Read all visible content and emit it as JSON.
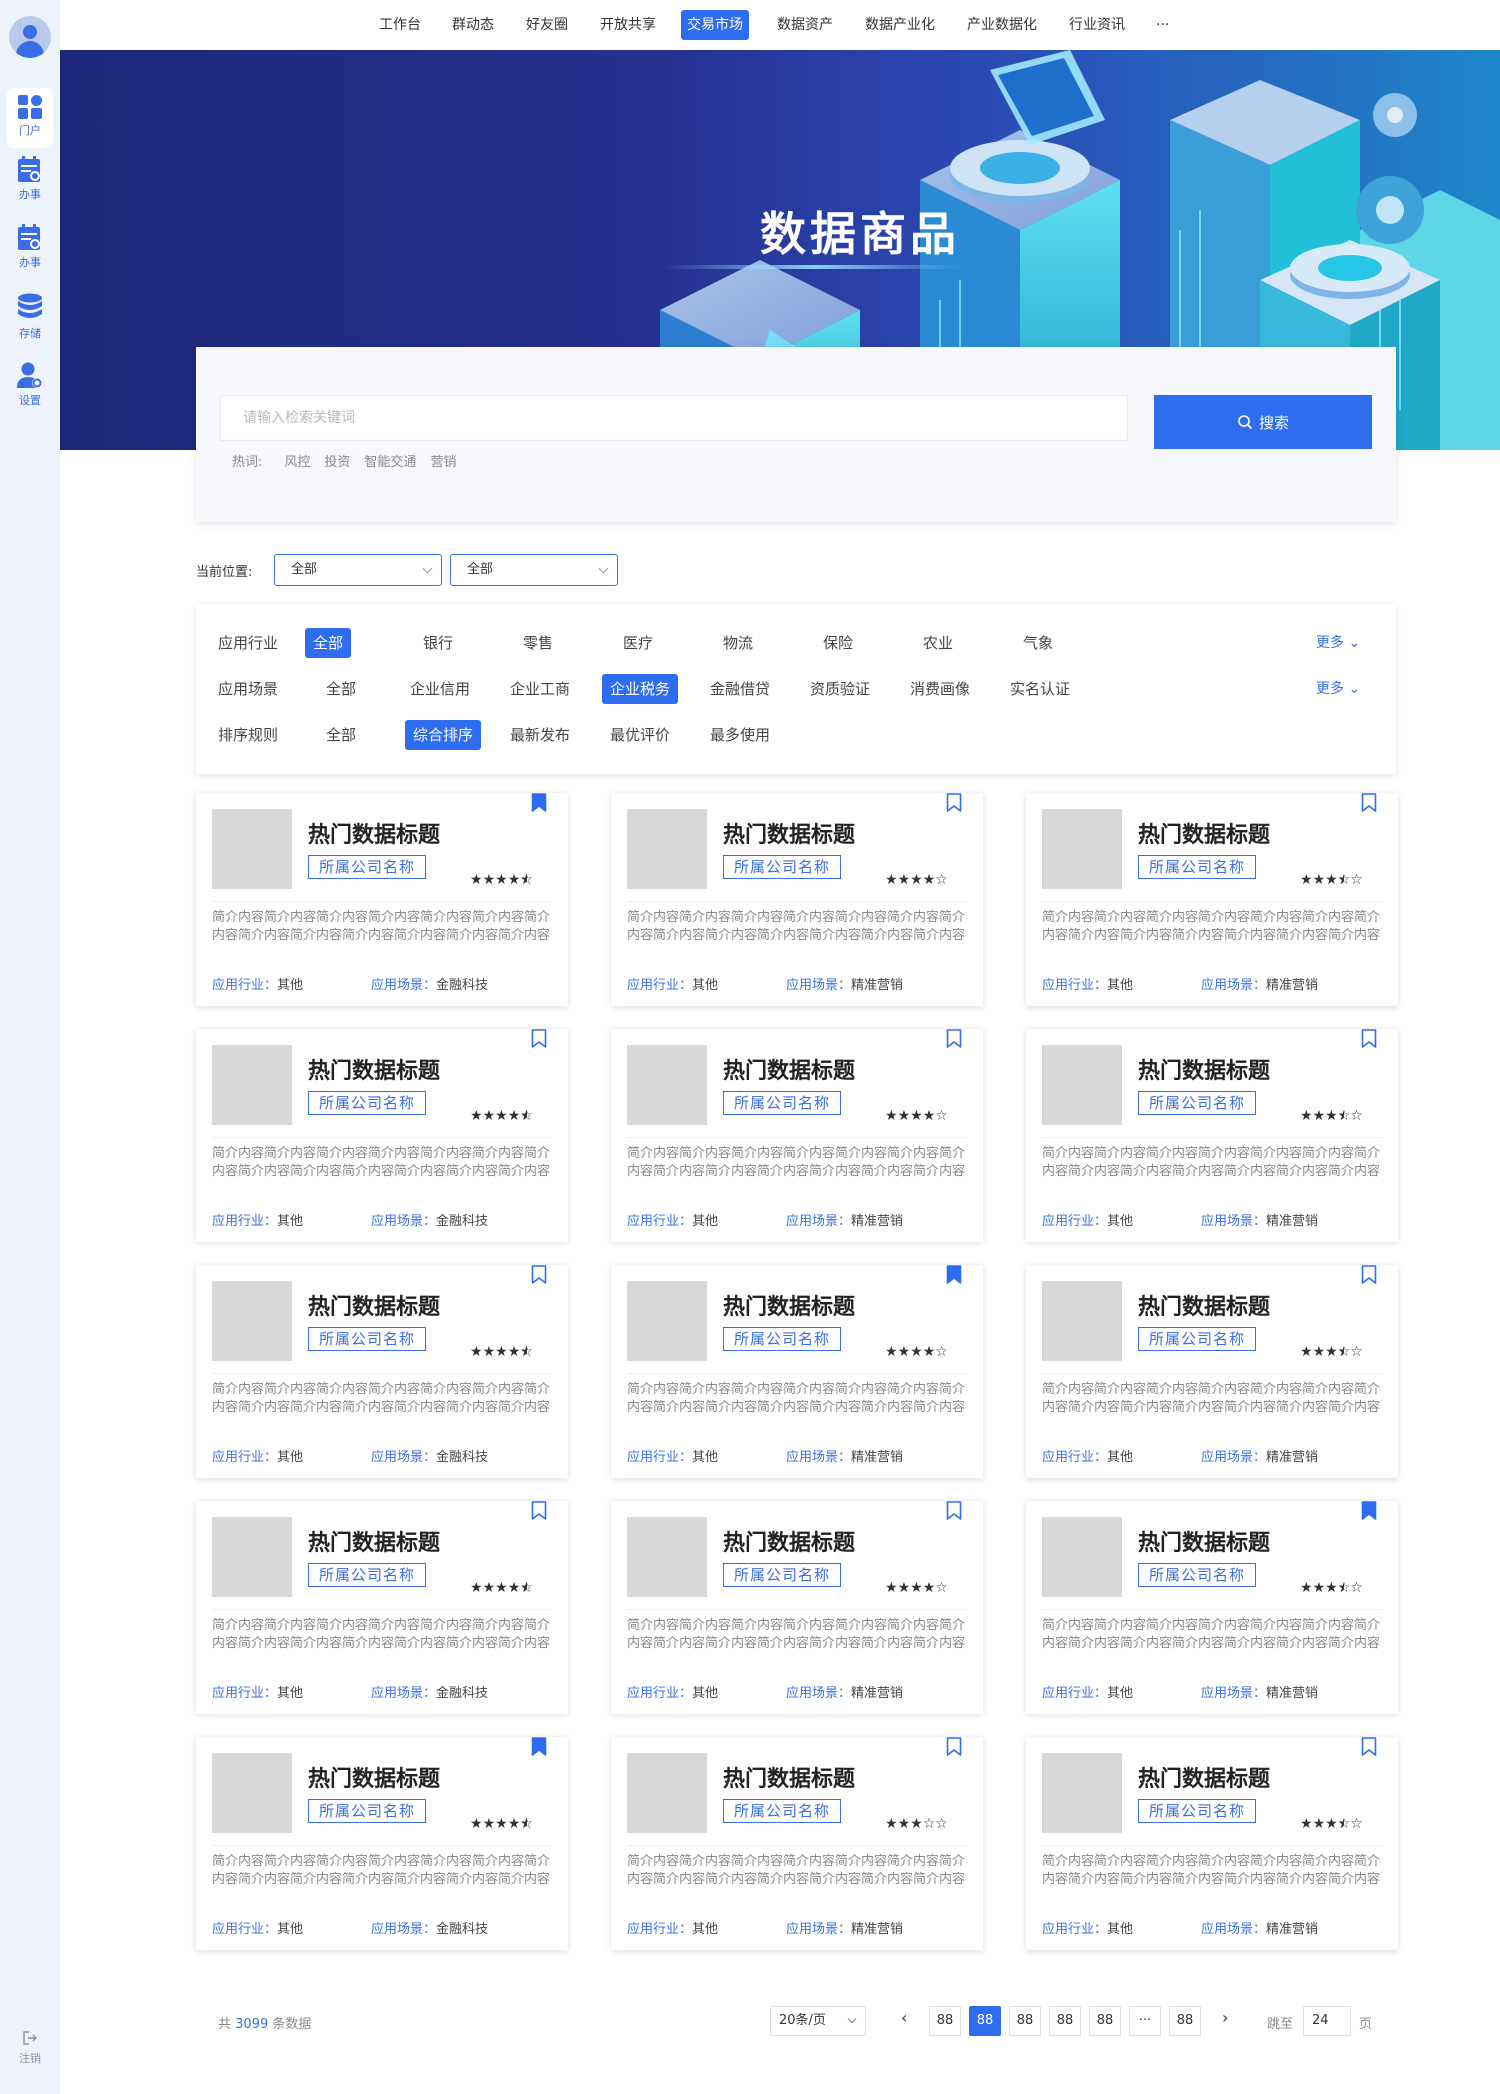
{
  "nav": {
    "items": [
      "工作台",
      "群动态",
      "好友圈",
      "开放共享",
      "交易市场",
      "数据资产",
      "数据产业化",
      "产业数据化",
      "行业资讯",
      "···"
    ],
    "active_index": 4
  },
  "sidebar": {
    "items": [
      {
        "label": "门户",
        "icon": "grid-icon"
      },
      {
        "label": "办事",
        "icon": "task-icon"
      },
      {
        "label": "办事",
        "icon": "task-icon"
      },
      {
        "label": "存储",
        "icon": "database-icon"
      },
      {
        "label": "设置",
        "icon": "user-settings-icon"
      }
    ],
    "logout": "注销"
  },
  "banner": {
    "title": "数据商品"
  },
  "search": {
    "placeholder": "请输入检索关键词",
    "button": "搜索",
    "hot_label": "热词:",
    "hot_words": [
      "风控",
      "投资",
      "智能交通",
      "营销"
    ]
  },
  "location": {
    "label": "当前位置:",
    "select1": "全部",
    "select2": "全部"
  },
  "filters": {
    "rows": [
      {
        "label": "应用行业",
        "options": [
          "全部",
          "银行",
          "零售",
          "医疗",
          "物流",
          "保险",
          "农业",
          "气象"
        ],
        "active": 0,
        "more": "更多"
      },
      {
        "label": "应用场景",
        "options": [
          "全部",
          "企业信用",
          "企业工商",
          "企业税务",
          "金融借贷",
          "资质验证",
          "消费画像",
          "实名认证"
        ],
        "active": 3,
        "more": "更多"
      },
      {
        "label": "排序规则",
        "options": [
          "全部",
          "综合排序",
          "最新发布",
          "最优评价",
          "最多使用"
        ],
        "active": 1
      }
    ]
  },
  "cards": [
    {
      "title": "热门数据标题",
      "company": "所属公司名称",
      "rating": 4.5,
      "bookmarked": true,
      "desc": "简介内容简介内容简介内容简介内容简介内容简介内容简介内容简介内容简介内容简介内容简介内容简介内容简介内容",
      "industry_label": "应用行业",
      "industry": "其他",
      "scene_label": "应用场景",
      "scene": "金融科技"
    },
    {
      "title": "热门数据标题",
      "company": "所属公司名称",
      "rating": 4,
      "bookmarked": false,
      "desc": "简介内容简介内容简介内容简介内容简介内容简介内容简介内容简介内容简介内容简介内容简介内容简介内容简介内容",
      "industry_label": "应用行业",
      "industry": "其他",
      "scene_label": "应用场景",
      "scene": "精准营销"
    },
    {
      "title": "热门数据标题",
      "company": "所属公司名称",
      "rating": 3.5,
      "bookmarked": false,
      "desc": "简介内容简介内容简介内容简介内容简介内容简介内容简介内容简介内容简介内容简介内容简介内容简介内容简介内容",
      "industry_label": "应用行业",
      "industry": "其他",
      "scene_label": "应用场景",
      "scene": "精准营销"
    },
    {
      "title": "热门数据标题",
      "company": "所属公司名称",
      "rating": 4.5,
      "bookmarked": false,
      "desc": "简介内容简介内容简介内容简介内容简介内容简介内容简介内容简介内容简介内容简介内容简介内容简介内容简介内容",
      "industry_label": "应用行业",
      "industry": "其他",
      "scene_label": "应用场景",
      "scene": "金融科技"
    },
    {
      "title": "热门数据标题",
      "company": "所属公司名称",
      "rating": 4,
      "bookmarked": false,
      "desc": "简介内容简介内容简介内容简介内容简介内容简介内容简介内容简介内容简介内容简介内容简介内容简介内容简介内容",
      "industry_label": "应用行业",
      "industry": "其他",
      "scene_label": "应用场景",
      "scene": "精准营销"
    },
    {
      "title": "热门数据标题",
      "company": "所属公司名称",
      "rating": 3.5,
      "bookmarked": false,
      "desc": "简介内容简介内容简介内容简介内容简介内容简介内容简介内容简介内容简介内容简介内容简介内容简介内容简介内容",
      "industry_label": "应用行业",
      "industry": "其他",
      "scene_label": "应用场景",
      "scene": "精准营销"
    },
    {
      "title": "热门数据标题",
      "company": "所属公司名称",
      "rating": 4.5,
      "bookmarked": false,
      "desc": "简介内容简介内容简介内容简介内容简介内容简介内容简介内容简介内容简介内容简介内容简介内容简介内容简介内容",
      "industry_label": "应用行业",
      "industry": "其他",
      "scene_label": "应用场景",
      "scene": "金融科技"
    },
    {
      "title": "热门数据标题",
      "company": "所属公司名称",
      "rating": 4,
      "bookmarked": true,
      "desc": "简介内容简介内容简介内容简介内容简介内容简介内容简介内容简介内容简介内容简介内容简介内容简介内容简介内容",
      "industry_label": "应用行业",
      "industry": "其他",
      "scene_label": "应用场景",
      "scene": "精准营销"
    },
    {
      "title": "热门数据标题",
      "company": "所属公司名称",
      "rating": 3.5,
      "bookmarked": false,
      "desc": "简介内容简介内容简介内容简介内容简介内容简介内容简介内容简介内容简介内容简介内容简介内容简介内容简介内容",
      "industry_label": "应用行业",
      "industry": "其他",
      "scene_label": "应用场景",
      "scene": "精准营销"
    },
    {
      "title": "热门数据标题",
      "company": "所属公司名称",
      "rating": 4.5,
      "bookmarked": false,
      "desc": "简介内容简介内容简介内容简介内容简介内容简介内容简介内容简介内容简介内容简介内容简介内容简介内容简介内容",
      "industry_label": "应用行业",
      "industry": "其他",
      "scene_label": "应用场景",
      "scene": "金融科技"
    },
    {
      "title": "热门数据标题",
      "company": "所属公司名称",
      "rating": 4,
      "bookmarked": false,
      "desc": "简介内容简介内容简介内容简介内容简介内容简介内容简介内容简介内容简介内容简介内容简介内容简介内容简介内容",
      "industry_label": "应用行业",
      "industry": "其他",
      "scene_label": "应用场景",
      "scene": "精准营销"
    },
    {
      "title": "热门数据标题",
      "company": "所属公司名称",
      "rating": 3.5,
      "bookmarked": true,
      "desc": "简介内容简介内容简介内容简介内容简介内容简介内容简介内容简介内容简介内容简介内容简介内容简介内容简介内容",
      "industry_label": "应用行业",
      "industry": "其他",
      "scene_label": "应用场景",
      "scene": "精准营销"
    },
    {
      "title": "热门数据标题",
      "company": "所属公司名称",
      "rating": 4.5,
      "bookmarked": true,
      "desc": "简介内容简介内容简介内容简介内容简介内容简介内容简介内容简介内容简介内容简介内容简介内容简介内容简介内容",
      "industry_label": "应用行业",
      "industry": "其他",
      "scene_label": "应用场景",
      "scene": "金融科技"
    },
    {
      "title": "热门数据标题",
      "company": "所属公司名称",
      "rating": 3,
      "bookmarked": false,
      "desc": "简介内容简介内容简介内容简介内容简介内容简介内容简介内容简介内容简介内容简介内容简介内容简介内容简介内容",
      "industry_label": "应用行业",
      "industry": "其他",
      "scene_label": "应用场景",
      "scene": "精准营销"
    },
    {
      "title": "热门数据标题",
      "company": "所属公司名称",
      "rating": 3.5,
      "bookmarked": false,
      "desc": "简介内容简介内容简介内容简介内容简介内容简介内容简介内容简介内容简介内容简介内容简介内容简介内容简介内容",
      "industry_label": "应用行业",
      "industry": "其他",
      "scene_label": "应用场景",
      "scene": "精准营销"
    }
  ],
  "pagination": {
    "total_prefix": "共",
    "total": "3099",
    "total_suffix": "条数据",
    "page_size": "20条/页",
    "pages": [
      "88",
      "88",
      "88",
      "88",
      "88",
      "···",
      "88"
    ],
    "active_index": 1,
    "prev": "‹",
    "next": "›",
    "jump_label": "跳至",
    "jump_value": "24",
    "jump_suffix": "页"
  },
  "colors": {
    "accent": "#2f6df0",
    "sidebar_bg": "#eef2fb",
    "banner_dark": "#1e2778"
  }
}
